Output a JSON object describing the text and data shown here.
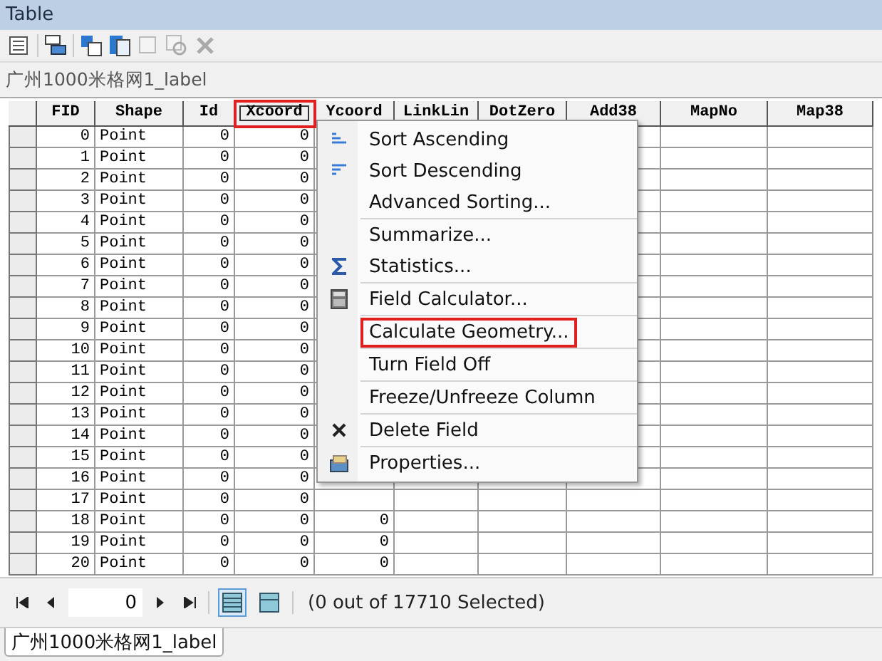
{
  "window": {
    "title": "Table"
  },
  "layer_name": "广州1000米格网1_label",
  "table": {
    "columns": [
      {
        "label": "FID",
        "selected": false
      },
      {
        "label": "Shape",
        "selected": false
      },
      {
        "label": "Id",
        "selected": false
      },
      {
        "label": "Xcoord",
        "selected": true
      },
      {
        "label": "Ycoord",
        "selected": false
      },
      {
        "label": "LinkLin",
        "selected": false
      },
      {
        "label": "DotZero",
        "selected": false
      },
      {
        "label": "Add38",
        "selected": false
      },
      {
        "label": "MapNo",
        "selected": false
      },
      {
        "label": "Map38",
        "selected": false
      }
    ],
    "rows": [
      {
        "cells": [
          "0",
          "Point",
          "0",
          "0"
        ]
      },
      {
        "cells": [
          "1",
          "Point",
          "0",
          "0"
        ]
      },
      {
        "cells": [
          "2",
          "Point",
          "0",
          "0"
        ]
      },
      {
        "cells": [
          "3",
          "Point",
          "0",
          "0"
        ]
      },
      {
        "cells": [
          "4",
          "Point",
          "0",
          "0"
        ]
      },
      {
        "cells": [
          "5",
          "Point",
          "0",
          "0"
        ]
      },
      {
        "cells": [
          "6",
          "Point",
          "0",
          "0"
        ]
      },
      {
        "cells": [
          "7",
          "Point",
          "0",
          "0"
        ]
      },
      {
        "cells": [
          "8",
          "Point",
          "0",
          "0"
        ]
      },
      {
        "cells": [
          "9",
          "Point",
          "0",
          "0"
        ]
      },
      {
        "cells": [
          "10",
          "Point",
          "0",
          "0"
        ]
      },
      {
        "cells": [
          "11",
          "Point",
          "0",
          "0"
        ]
      },
      {
        "cells": [
          "12",
          "Point",
          "0",
          "0"
        ]
      },
      {
        "cells": [
          "13",
          "Point",
          "0",
          "0"
        ]
      },
      {
        "cells": [
          "14",
          "Point",
          "0",
          "0"
        ]
      },
      {
        "cells": [
          "15",
          "Point",
          "0",
          "0"
        ]
      },
      {
        "cells": [
          "16",
          "Point",
          "0",
          "0"
        ]
      },
      {
        "cells": [
          "17",
          "Point",
          "0",
          "0"
        ]
      },
      {
        "cells": [
          "18",
          "Point",
          "0",
          "0",
          "0"
        ]
      },
      {
        "cells": [
          "19",
          "Point",
          "0",
          "0",
          "0"
        ]
      },
      {
        "cells": [
          "20",
          "Point",
          "0",
          "0",
          "0"
        ]
      }
    ]
  },
  "context_menu": {
    "items": [
      {
        "label": "Sort Ascending",
        "kind": "ascending",
        "highlighted": false
      },
      {
        "label": "Sort Descending",
        "kind": "descending",
        "highlighted": false
      },
      {
        "label": "Advanced Sorting...",
        "kind": "plain",
        "highlighted": false
      },
      {
        "kind": "separator"
      },
      {
        "label": "Summarize...",
        "kind": "plain",
        "highlighted": false
      },
      {
        "label": "Statistics...",
        "kind": "sigma",
        "highlighted": false
      },
      {
        "kind": "separator"
      },
      {
        "label": "Field Calculator...",
        "kind": "calculator",
        "highlighted": false
      },
      {
        "kind": "separator"
      },
      {
        "label": "Calculate Geometry...",
        "kind": "plain",
        "highlighted": true
      },
      {
        "kind": "separator"
      },
      {
        "label": "Turn Field Off",
        "kind": "plain",
        "highlighted": false
      },
      {
        "kind": "separator"
      },
      {
        "label": "Freeze/Unfreeze Column",
        "kind": "plain",
        "highlighted": false
      },
      {
        "kind": "separator"
      },
      {
        "label": "Delete Field",
        "kind": "delete",
        "highlighted": false
      },
      {
        "kind": "separator"
      },
      {
        "label": "Properties...",
        "kind": "properties",
        "highlighted": false
      }
    ]
  },
  "navigator": {
    "record": "0",
    "views": [
      {
        "selected": true
      },
      {
        "selected": false
      }
    ],
    "status": "(0 out of 17710 Selected)"
  },
  "tabs": [
    {
      "label": "广州1000米格网1_label",
      "selected": true
    }
  ]
}
